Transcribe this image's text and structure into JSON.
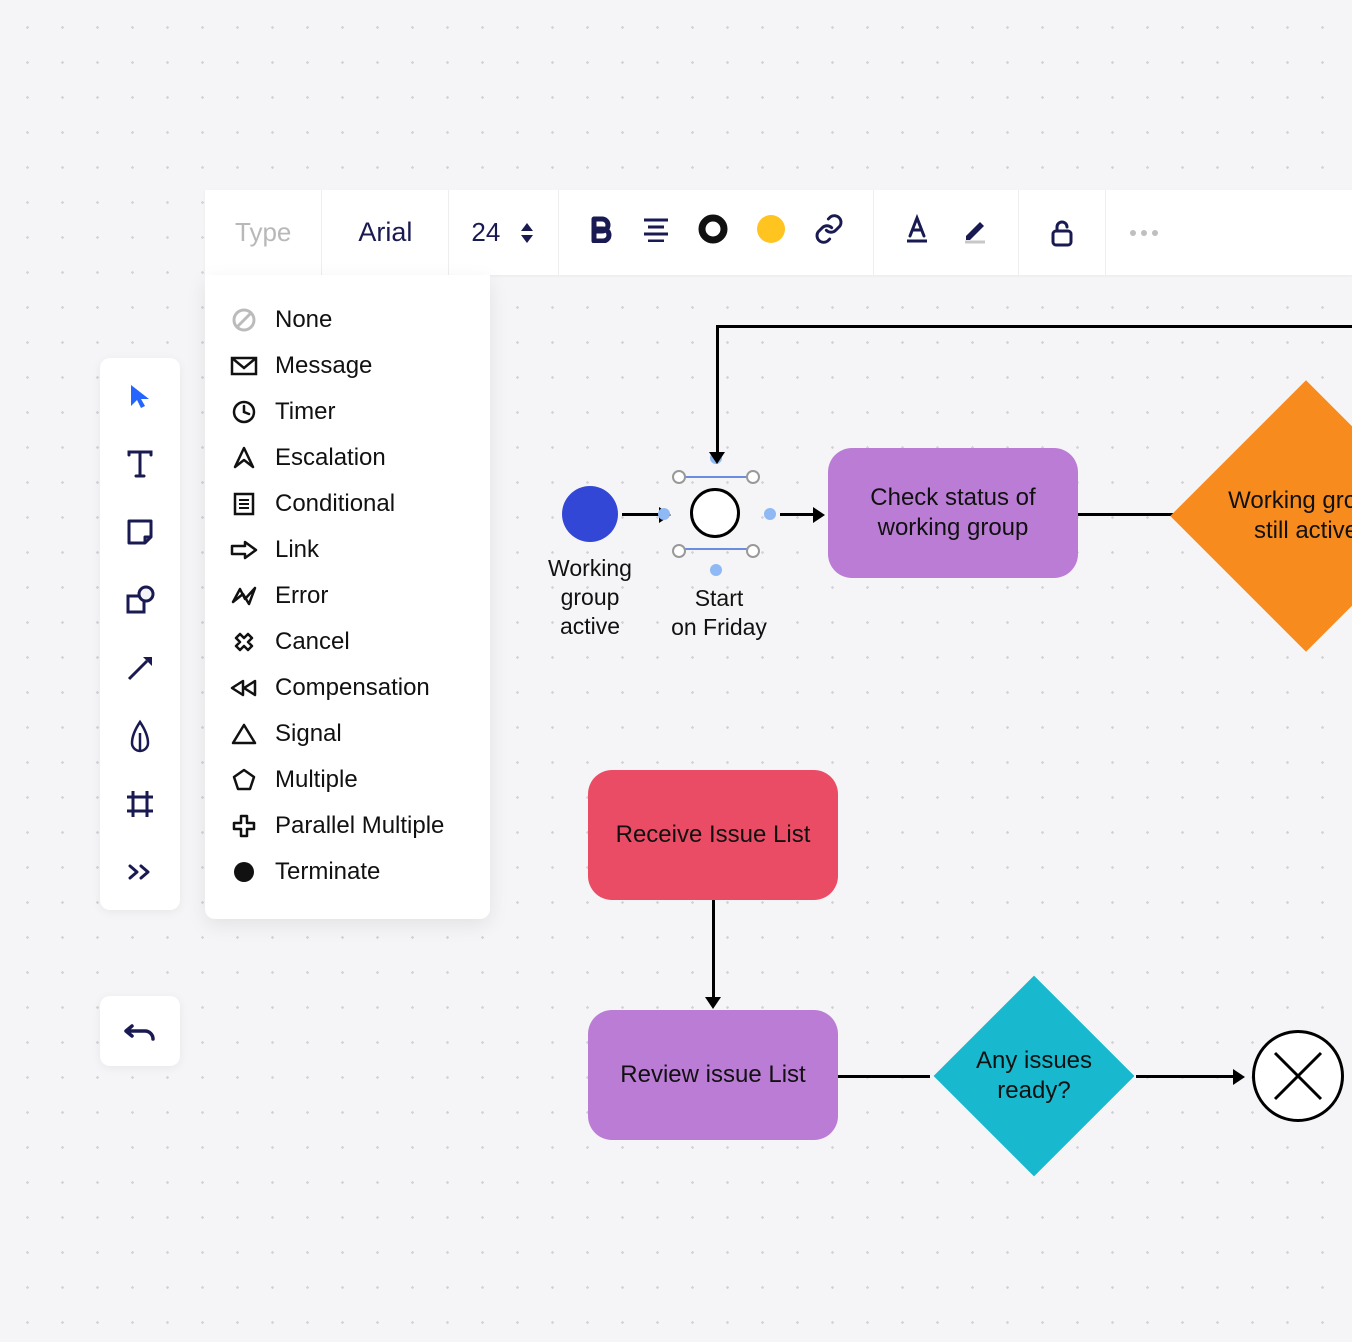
{
  "toolbar_top": {
    "type_label": "Type",
    "font_name": "Arial",
    "font_size": "24"
  },
  "type_menu": {
    "items": [
      "None",
      "Message",
      "Timer",
      "Escalation",
      "Conditional",
      "Link",
      "Error",
      "Cancel",
      "Compensation",
      "Signal",
      "Multiple",
      "Parallel Multiple",
      "Terminate"
    ]
  },
  "nodes": {
    "start_event_label": "Working\ngroup\nactive",
    "timer_event_label": "Start\non Friday",
    "check_status": "Check status of working group",
    "working_group_active": "Working group still active",
    "receive_issue": "Receive Issue List",
    "review_issue": "Review issue List",
    "any_issues": "Any issues ready?"
  },
  "colors": {
    "blue": "#3247d5",
    "purple": "#bb7cd6",
    "orange": "#f78b1e",
    "pink": "#eb4c65",
    "teal": "#18b8ce",
    "darknavy": "#1a1a52",
    "yellow": "#ffc41f"
  }
}
